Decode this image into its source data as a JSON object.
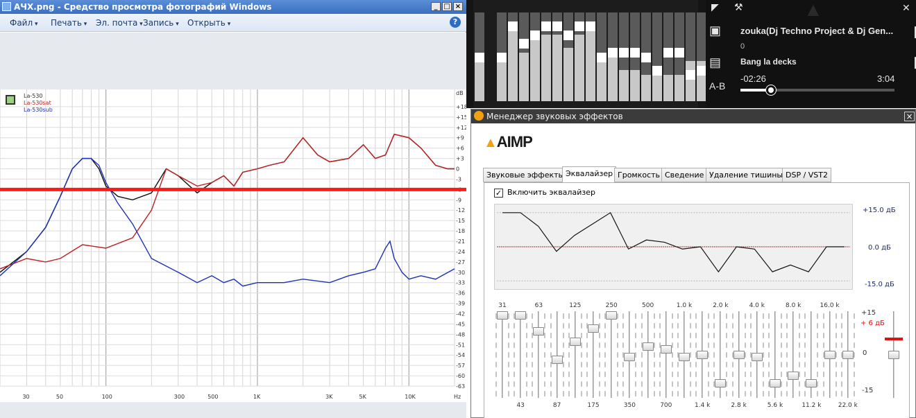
{
  "viewer": {
    "title": "АЧХ.png - Средство просмотра фотографий Windows",
    "menu": [
      "Файл",
      "Печать",
      "Эл. почта",
      "Запись",
      "Открыть"
    ],
    "window_buttons": [
      "_",
      "□",
      "×"
    ]
  },
  "graph": {
    "legend": [
      "La-530",
      "La-530sat",
      "La-530sub"
    ],
    "db_unit": "dB",
    "y_ticks": [
      "+18",
      "+15",
      "+12",
      "+9",
      "+6",
      "+3",
      "0",
      "-3",
      "-6",
      "-9",
      "-12",
      "-15",
      "-18",
      "-21",
      "-24",
      "-27",
      "-30",
      "-33",
      "-36",
      "-39",
      "-42",
      "-45",
      "-48",
      "-51",
      "-54",
      "-57",
      "-60",
      "-63"
    ],
    "x_ticks": [
      "30",
      "50",
      "100",
      "300",
      "500",
      "1K",
      "3K",
      "5K",
      "10K",
      "Hz"
    ],
    "reference_db": -6
  },
  "chart_data": {
    "type": "line",
    "xlabel": "Hz",
    "ylabel": "dB",
    "x_scale": "log",
    "xlim": [
      20,
      20000
    ],
    "ylim": [
      -63,
      21
    ],
    "reference_line_db": -6,
    "series": [
      {
        "name": "La-530",
        "color": "#111111",
        "x": [
          20,
          30,
          40,
          50,
          60,
          70,
          80,
          90,
          100,
          120,
          150,
          200,
          250,
          300,
          400,
          500,
          600,
          700,
          800,
          1000,
          1200,
          1500,
          2000,
          2500,
          3000,
          4000,
          5000,
          6000,
          7000,
          8000,
          10000,
          12000,
          15000,
          18000,
          20000
        ],
        "y": [
          -30,
          -24,
          -17,
          -8,
          0,
          3,
          3,
          0,
          -5,
          -8,
          -9,
          -7,
          0,
          -2,
          -7,
          -4,
          -2,
          -5,
          -1,
          0,
          1,
          2,
          9,
          4,
          2,
          3,
          7,
          3,
          4,
          10,
          9,
          6,
          1,
          0,
          0
        ]
      },
      {
        "name": "La-530sat",
        "color": "#c02020",
        "x": [
          20,
          30,
          40,
          50,
          70,
          100,
          150,
          200,
          250,
          300,
          400,
          500,
          600,
          700,
          800,
          1000,
          1200,
          1500,
          2000,
          2500,
          3000,
          4000,
          5000,
          6000,
          7000,
          8000,
          10000,
          12000,
          15000,
          18000,
          20000
        ],
        "y": [
          -29,
          -26,
          -27,
          -26,
          -22,
          -23,
          -20,
          -12,
          0,
          -2,
          -5,
          -4,
          -2,
          -5,
          -1,
          0,
          1,
          2,
          9,
          4,
          2,
          3,
          7,
          3,
          4,
          10,
          9,
          6,
          1,
          0,
          0
        ]
      },
      {
        "name": "La-530sub",
        "color": "#1c2fb8",
        "x": [
          20,
          30,
          40,
          50,
          60,
          70,
          80,
          90,
          100,
          120,
          150,
          200,
          300,
          400,
          500,
          600,
          700,
          800,
          1000,
          1500,
          2000,
          3000,
          4000,
          5000,
          6000,
          7000,
          7500,
          8000,
          9000,
          10000,
          12000,
          15000,
          20000
        ],
        "y": [
          -31,
          -24,
          -17,
          -8,
          0,
          3,
          3,
          1,
          -4,
          -10,
          -16,
          -26,
          -30,
          -33,
          -31,
          -33,
          -32,
          -34,
          -33,
          -33,
          -32,
          -33,
          -31,
          -30,
          -29,
          -23,
          -21,
          -26,
          -30,
          -32,
          -31,
          -32,
          -29
        ]
      }
    ]
  },
  "aimp": {
    "track_title": "zouka(Dj Techno Project & Dj Gen...",
    "track_number": "0",
    "album": "Bang la decks",
    "time_elapsed": "-02:26",
    "time_total": "3:04",
    "ab_label": "A-B",
    "progress": 0.2,
    "spectrum_levels": [
      0.55,
      0.55,
      0.9,
      0.55,
      0.75,
      0.75,
      0.75,
      0.6,
      0.75,
      0.9,
      0.5,
      0.5,
      0.35,
      0.35,
      0.3,
      0.35,
      0.3,
      0.3,
      0.45,
      0.45,
      0.3,
      0.45
    ],
    "spectrum_peaks": [
      0.55,
      0.55,
      0.9,
      0.7,
      0.8,
      0.9,
      0.9,
      0.8,
      0.9,
      0.9,
      0.55,
      0.6,
      0.6,
      0.6,
      0.55,
      0.4,
      0.6,
      0.6,
      0.35,
      0.4,
      0.45,
      0.55
    ]
  },
  "fx": {
    "title": "Менеджер звуковых эффектов",
    "logo": "AIMP",
    "close": "×",
    "tabs": [
      "Звуковые эффекты",
      "Эквалайзер",
      "Громкость",
      "Сведение",
      "Удаление тишины",
      "DSP / VST2"
    ],
    "active_tab": 1,
    "enable_label": "Включить эквалайзер",
    "enable_checked": true,
    "curve_labels": [
      "+15.0 дБ",
      "0.0 дБ",
      "-15.0 дБ"
    ],
    "scale_labels": [
      "+15",
      "0",
      "-15"
    ],
    "preamp_label": "+ 6 дБ",
    "preamp_db": 6,
    "preamp_color": "#e01010",
    "bands_top": [
      "31",
      "63",
      "125",
      "250",
      "500",
      "1.0 k",
      "2.0 k",
      "4.0 k",
      "8.0 k",
      "16.0 k"
    ],
    "bands_bottom": [
      "43",
      "87",
      "175",
      "350",
      "700",
      "1.4 k",
      "2.8 k",
      "5.6 k",
      "11.2 k",
      "22.0 k"
    ],
    "band_gains_db": [
      15,
      15,
      9,
      -2,
      5,
      10,
      15,
      -1,
      3,
      2,
      -1,
      0,
      -11,
      0,
      -1,
      -11,
      -8,
      -11,
      0,
      0
    ]
  }
}
